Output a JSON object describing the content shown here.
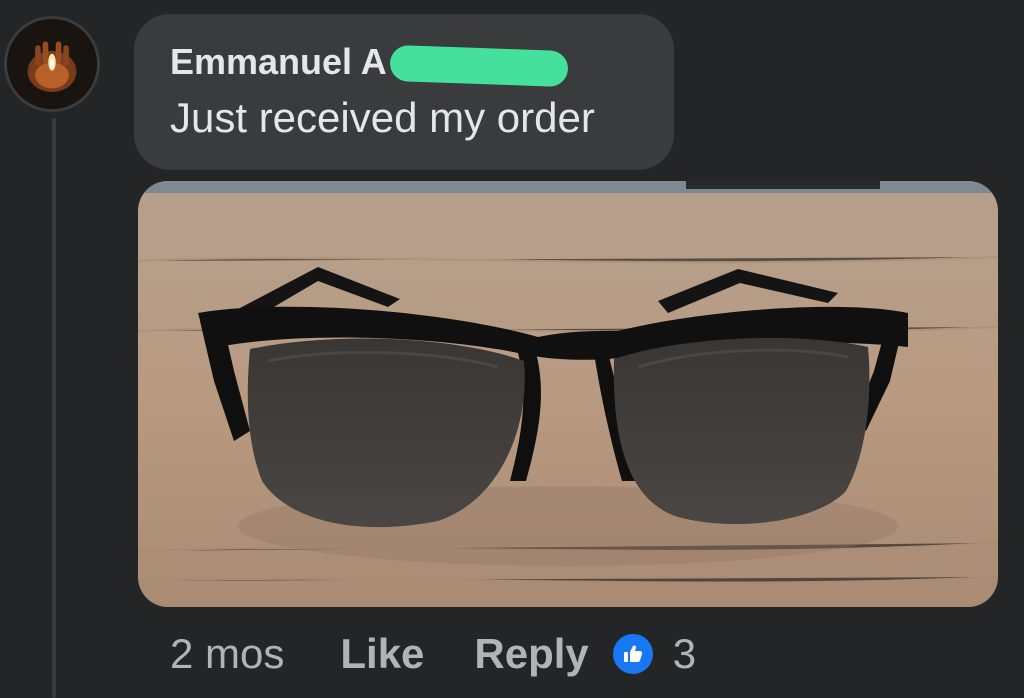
{
  "comment": {
    "author": "Emmanuel A        a",
    "text": "Just received my order",
    "timestamp": "2 mos",
    "like_label": "Like",
    "reply_label": "Reply",
    "reaction_count": "3",
    "reaction_icon": "thumbs-up-icon",
    "reaction_color": "#1877f2",
    "redaction_color": "#45e09c"
  },
  "colors": {
    "background": "#242526",
    "bubble": "#3a3b3c",
    "primary_text": "#e4e6eb",
    "secondary_text": "#b0b3b8"
  },
  "photo": {
    "subject": "sunglasses-photo"
  }
}
